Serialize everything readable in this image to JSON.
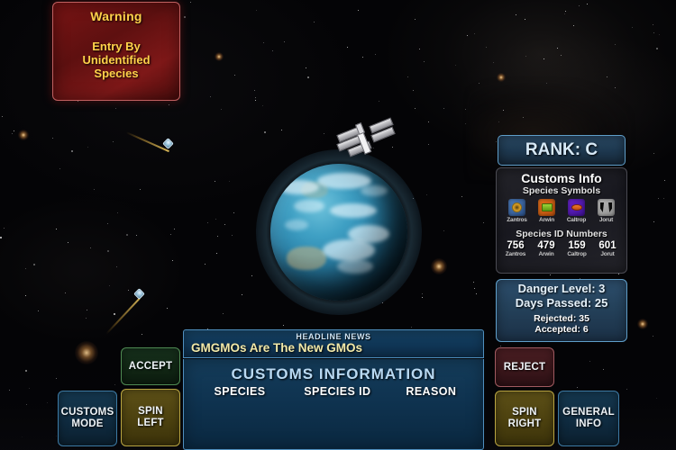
{
  "warning": {
    "title": "Warning",
    "line1": "Entry By",
    "line2": "Unidentified",
    "line3": "Species",
    "border_color": "#c06060",
    "text_color": "#ffd24a"
  },
  "hud": {
    "rank_label": "RANK: C",
    "customs_info": {
      "title": "Customs Info",
      "symbols_heading": "Species Symbols",
      "symbols": [
        {
          "name": "Zantros",
          "icon": "circle-emblem-icon",
          "bg": "#3d6aa8",
          "fg": "#d9a42e"
        },
        {
          "name": "Arwin",
          "icon": "bar-emblem-icon",
          "bg": "#d4620f",
          "fg": "#7fbb22"
        },
        {
          "name": "Caltrop",
          "icon": "oval-emblem-icon",
          "bg": "#5318b0",
          "fg": "#e06a1c"
        },
        {
          "name": "Jorut",
          "icon": "fangs-emblem-icon",
          "bg": "#a8a8a8",
          "fg": "#0a0a0a"
        }
      ],
      "ids_heading": "Species ID Numbers",
      "ids": [
        {
          "number": "756",
          "name": "Zantros"
        },
        {
          "number": "479",
          "name": "Arwin"
        },
        {
          "number": "159",
          "name": "Caltrop"
        },
        {
          "number": "601",
          "name": "Jorut"
        }
      ]
    },
    "status": {
      "danger_level": "Danger Level: 3",
      "days_passed": "Days Passed: 25",
      "rejected": "Rejected: 35",
      "accepted": "Accepted: 6"
    }
  },
  "news": {
    "heading": "HEADLINE NEWS",
    "ticker": "GMGMOs Are The New GMOs"
  },
  "customs": {
    "title": "CUSTOMS INFORMATION",
    "columns": [
      "SPECIES",
      "SPECIES ID",
      "REASON"
    ],
    "rows": []
  },
  "buttons": {
    "customs_mode": "CUSTOMS\nMODE",
    "customs_mode_l1": "CUSTOMS",
    "customs_mode_l2": "MODE",
    "accept": "ACCEPT",
    "spin_left_l1": "SPIN",
    "spin_left_l2": "LEFT",
    "reject": "REJECT",
    "spin_right_l1": "SPIN",
    "spin_right_l2": "RIGHT",
    "general_info_l1": "GENERAL",
    "general_info_l2": "INFO"
  },
  "scene": {
    "planet_name": "earth-like-planet",
    "station_name": "space-station",
    "ships": [
      "incoming-ship-upper",
      "incoming-ship-lower"
    ]
  }
}
